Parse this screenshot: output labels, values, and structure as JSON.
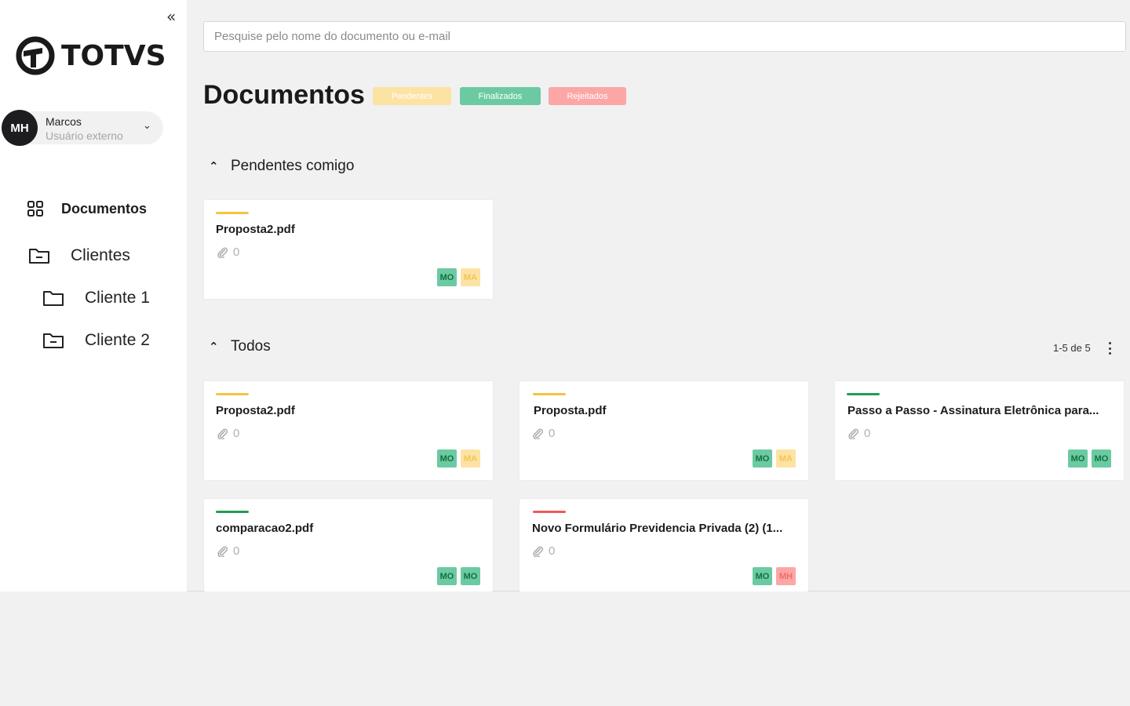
{
  "sidebar": {
    "collapse_icon": "«",
    "logo_text": "TOTVS",
    "user": {
      "initials": "MH",
      "name": "Marcos",
      "role": "Usuário externo"
    },
    "nav": [
      {
        "label": "Documentos",
        "icon": "grid-icon",
        "active": true
      },
      {
        "label": "Clientes",
        "icon": "folder-icon"
      },
      {
        "label": "Cliente 1",
        "icon": "folder-icon"
      },
      {
        "label": "Cliente 2",
        "icon": "folder-icon"
      }
    ]
  },
  "search": {
    "placeholder": "Pesquise pelo nome do documento ou e-mail",
    "value": ""
  },
  "header": {
    "title": "Documentos",
    "filters": [
      "Pendentes",
      "Finalizados",
      "Rejeitados"
    ]
  },
  "sections": {
    "pending": {
      "title": "Pendentes comigo",
      "cards": [
        {
          "title": "Proposta2.pdf",
          "attachments": "0",
          "status_color": "#f5c443",
          "tags": [
            {
              "text": "MO",
              "color": "green"
            },
            {
              "text": "MA",
              "color": "yellow"
            }
          ]
        }
      ]
    },
    "all": {
      "title": "Todos",
      "pager": "1-5 de 5",
      "cards": [
        {
          "title": "Proposta2.pdf",
          "attachments": "0",
          "status_color": "#f5c443",
          "tags": [
            {
              "text": "MO",
              "color": "green"
            },
            {
              "text": "MA",
              "color": "yellow"
            }
          ]
        },
        {
          "title": "Proposta.pdf",
          "attachments": "0",
          "status_color": "#f5c443",
          "tags": [
            {
              "text": "MO",
              "color": "green"
            },
            {
              "text": "MA",
              "color": "yellow"
            }
          ]
        },
        {
          "title": "Passo a Passo - Assinatura Eletrônica para...",
          "attachments": "0",
          "status_color": "#1e9e52",
          "tags": [
            {
              "text": "MO",
              "color": "green"
            },
            {
              "text": "MO",
              "color": "green"
            }
          ]
        },
        {
          "title": "comparacao2.pdf",
          "attachments": "0",
          "status_color": "#1e9e52",
          "tags": [
            {
              "text": "MO",
              "color": "green"
            },
            {
              "text": "MO",
              "color": "green"
            }
          ]
        },
        {
          "title": "Novo Formulário Previdencia Privada (2) (1...",
          "attachments": "0",
          "status_color": "#ef5a5a",
          "tags": [
            {
              "text": "MO",
              "color": "green"
            },
            {
              "text": "MH",
              "color": "red"
            }
          ]
        }
      ]
    }
  }
}
